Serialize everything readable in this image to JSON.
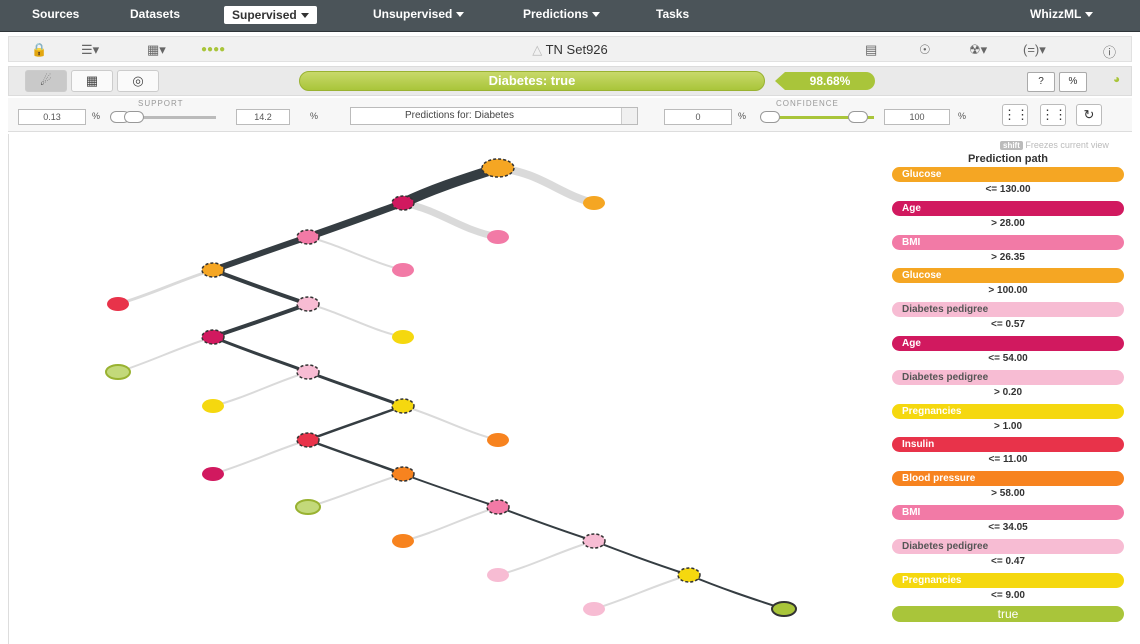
{
  "nav": {
    "sources": "Sources",
    "datasets": "Datasets",
    "supervised": "Supervised",
    "unsupervised": "Unsupervised",
    "predictions": "Predictions",
    "tasks": "Tasks",
    "user": "WhizzML"
  },
  "resource": {
    "title": "TN Set926"
  },
  "prediction": {
    "label": "Diabetes: true",
    "confidence": "98.68%"
  },
  "controls": {
    "support_label": "SUPPORT",
    "support_min": "0.13",
    "support_max": "14.2",
    "unit": "%",
    "predictions_for": "Predictions for: Diabetes",
    "confidence_label": "CONFIDENCE",
    "confidence_min": "0",
    "confidence_max": "100"
  },
  "shift": {
    "key": "shift",
    "text": "Freezes current view"
  },
  "path_panel": {
    "header": "Prediction path",
    "steps": [
      {
        "field": "Glucose",
        "cond": "<= 130.00",
        "color": "#f5a623",
        "light": false
      },
      {
        "field": "Age",
        "cond": "> 28.00",
        "color": "#d1195f",
        "light": false
      },
      {
        "field": "BMI",
        "cond": "> 26.35",
        "color": "#f27aa6",
        "light": false
      },
      {
        "field": "Glucose",
        "cond": "> 100.00",
        "color": "#f5a623",
        "light": false
      },
      {
        "field": "Diabetes pedigree",
        "cond": "<= 0.57",
        "color": "#f7bcd3",
        "light": true
      },
      {
        "field": "Age",
        "cond": "<= 54.00",
        "color": "#d1195f",
        "light": false
      },
      {
        "field": "Diabetes pedigree",
        "cond": "> 0.20",
        "color": "#f7bcd3",
        "light": true
      },
      {
        "field": "Pregnancies",
        "cond": "> 1.00",
        "color": "#f5d80f",
        "light": false
      },
      {
        "field": "Insulin",
        "cond": "<= 11.00",
        "color": "#e8334a",
        "light": false
      },
      {
        "field": "Blood pressure",
        "cond": "> 58.00",
        "color": "#f7831f",
        "light": false
      },
      {
        "field": "BMI",
        "cond": "<= 34.05",
        "color": "#f27aa6",
        "light": false
      },
      {
        "field": "Diabetes pedigree",
        "cond": "<= 0.47",
        "color": "#f7bcd3",
        "light": true
      },
      {
        "field": "Pregnancies",
        "cond": "<= 9.00",
        "color": "#f5d80f",
        "light": false
      }
    ],
    "result": "true"
  },
  "colors": {
    "nav_bg": "#4b5459",
    "accent_green": "#a9c53a",
    "path_dark": "#353d42"
  }
}
